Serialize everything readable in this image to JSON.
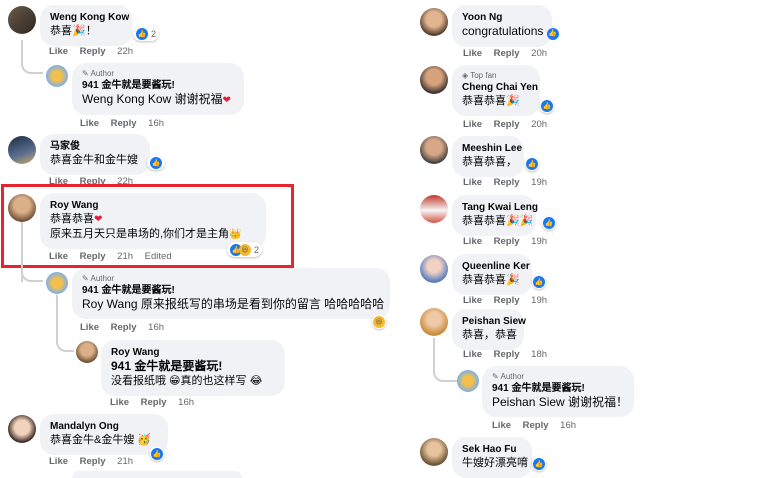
{
  "left": {
    "c1": {
      "name": "Weng Kong Kow",
      "text": "恭喜🎉！",
      "like": "Like",
      "reply": "Reply",
      "time": "22h",
      "react_count": "2"
    },
    "r1": {
      "tag": "Author",
      "name": "941 金牛就是要酱玩!",
      "text": "Weng Kong Kow 谢谢祝福",
      "like": "Like",
      "reply": "Reply",
      "time": "16h"
    },
    "c2": {
      "name": "马家俊",
      "text": "恭喜金牛和金牛嫂",
      "like": "Like",
      "reply": "Reply",
      "time": "22h"
    },
    "c3": {
      "name": "Roy Wang",
      "line1": "恭喜恭喜",
      "line2": "原来五月天只是串场的,你们才是主角",
      "like": "Like",
      "reply": "Reply",
      "time": "21h",
      "edited": "Edited",
      "react_count": "2"
    },
    "r3a": {
      "tag": "Author",
      "name": "941 金牛就是要酱玩!",
      "text": "Roy Wang 原来报纸写的串场是看到你的留言 哈哈哈哈哈",
      "like": "Like",
      "reply": "Reply",
      "time": "16h"
    },
    "r3b": {
      "name": "Roy Wang",
      "line1": "941 金牛就是要酱玩!",
      "line2": "没看报纸哦 😁真的也这样写 😂",
      "like": "Like",
      "reply": "Reply",
      "time": "16h"
    },
    "c4": {
      "name": "Mandalyn Ong",
      "text": "恭喜金牛&金牛嫂 🥳",
      "like": "Like",
      "reply": "Reply",
      "time": "21h"
    }
  },
  "right": {
    "c1": {
      "name": "Yoon Ng",
      "text": "congratulations",
      "like": "Like",
      "reply": "Reply",
      "time": "20h"
    },
    "c2": {
      "tag": "Top fan",
      "name": "Cheng Chai Yen",
      "text": "恭喜恭喜🎉",
      "like": "Like",
      "reply": "Reply",
      "time": "20h"
    },
    "c3": {
      "name": "Meeshin Lee",
      "text": "恭喜恭喜，",
      "like": "Like",
      "reply": "Reply",
      "time": "19h"
    },
    "c4": {
      "name": "Tang Kwai Leng",
      "text": "恭喜恭喜🎉🎉",
      "like": "Like",
      "reply": "Reply",
      "time": "19h"
    },
    "c5": {
      "name": "Queenline Ker",
      "text": "恭喜恭喜🎉",
      "like": "Like",
      "reply": "Reply",
      "time": "19h"
    },
    "c6": {
      "name": "Peishan Siew",
      "text": "恭喜，恭喜",
      "like": "Like",
      "reply": "Reply",
      "time": "18h"
    },
    "r6": {
      "tag": "Author",
      "name": "941 金牛就是要酱玩!",
      "text": "Peishan Siew 谢谢祝福！",
      "like": "Like",
      "reply": "Reply",
      "time": "16h"
    },
    "c7": {
      "name": "Sek Hao Fu",
      "text": "牛嫂好漂亮唷"
    }
  },
  "icons": {
    "like": "like-icon",
    "haha": "haha-icon",
    "heart": "heart-icon",
    "pencil": "pencil-icon",
    "star": "top-fan-icon"
  },
  "colors": {
    "bubble": "#f0f2f5",
    "highlight": "#e8252e",
    "like_blue": "#1877f2",
    "meta": "#65676b"
  }
}
